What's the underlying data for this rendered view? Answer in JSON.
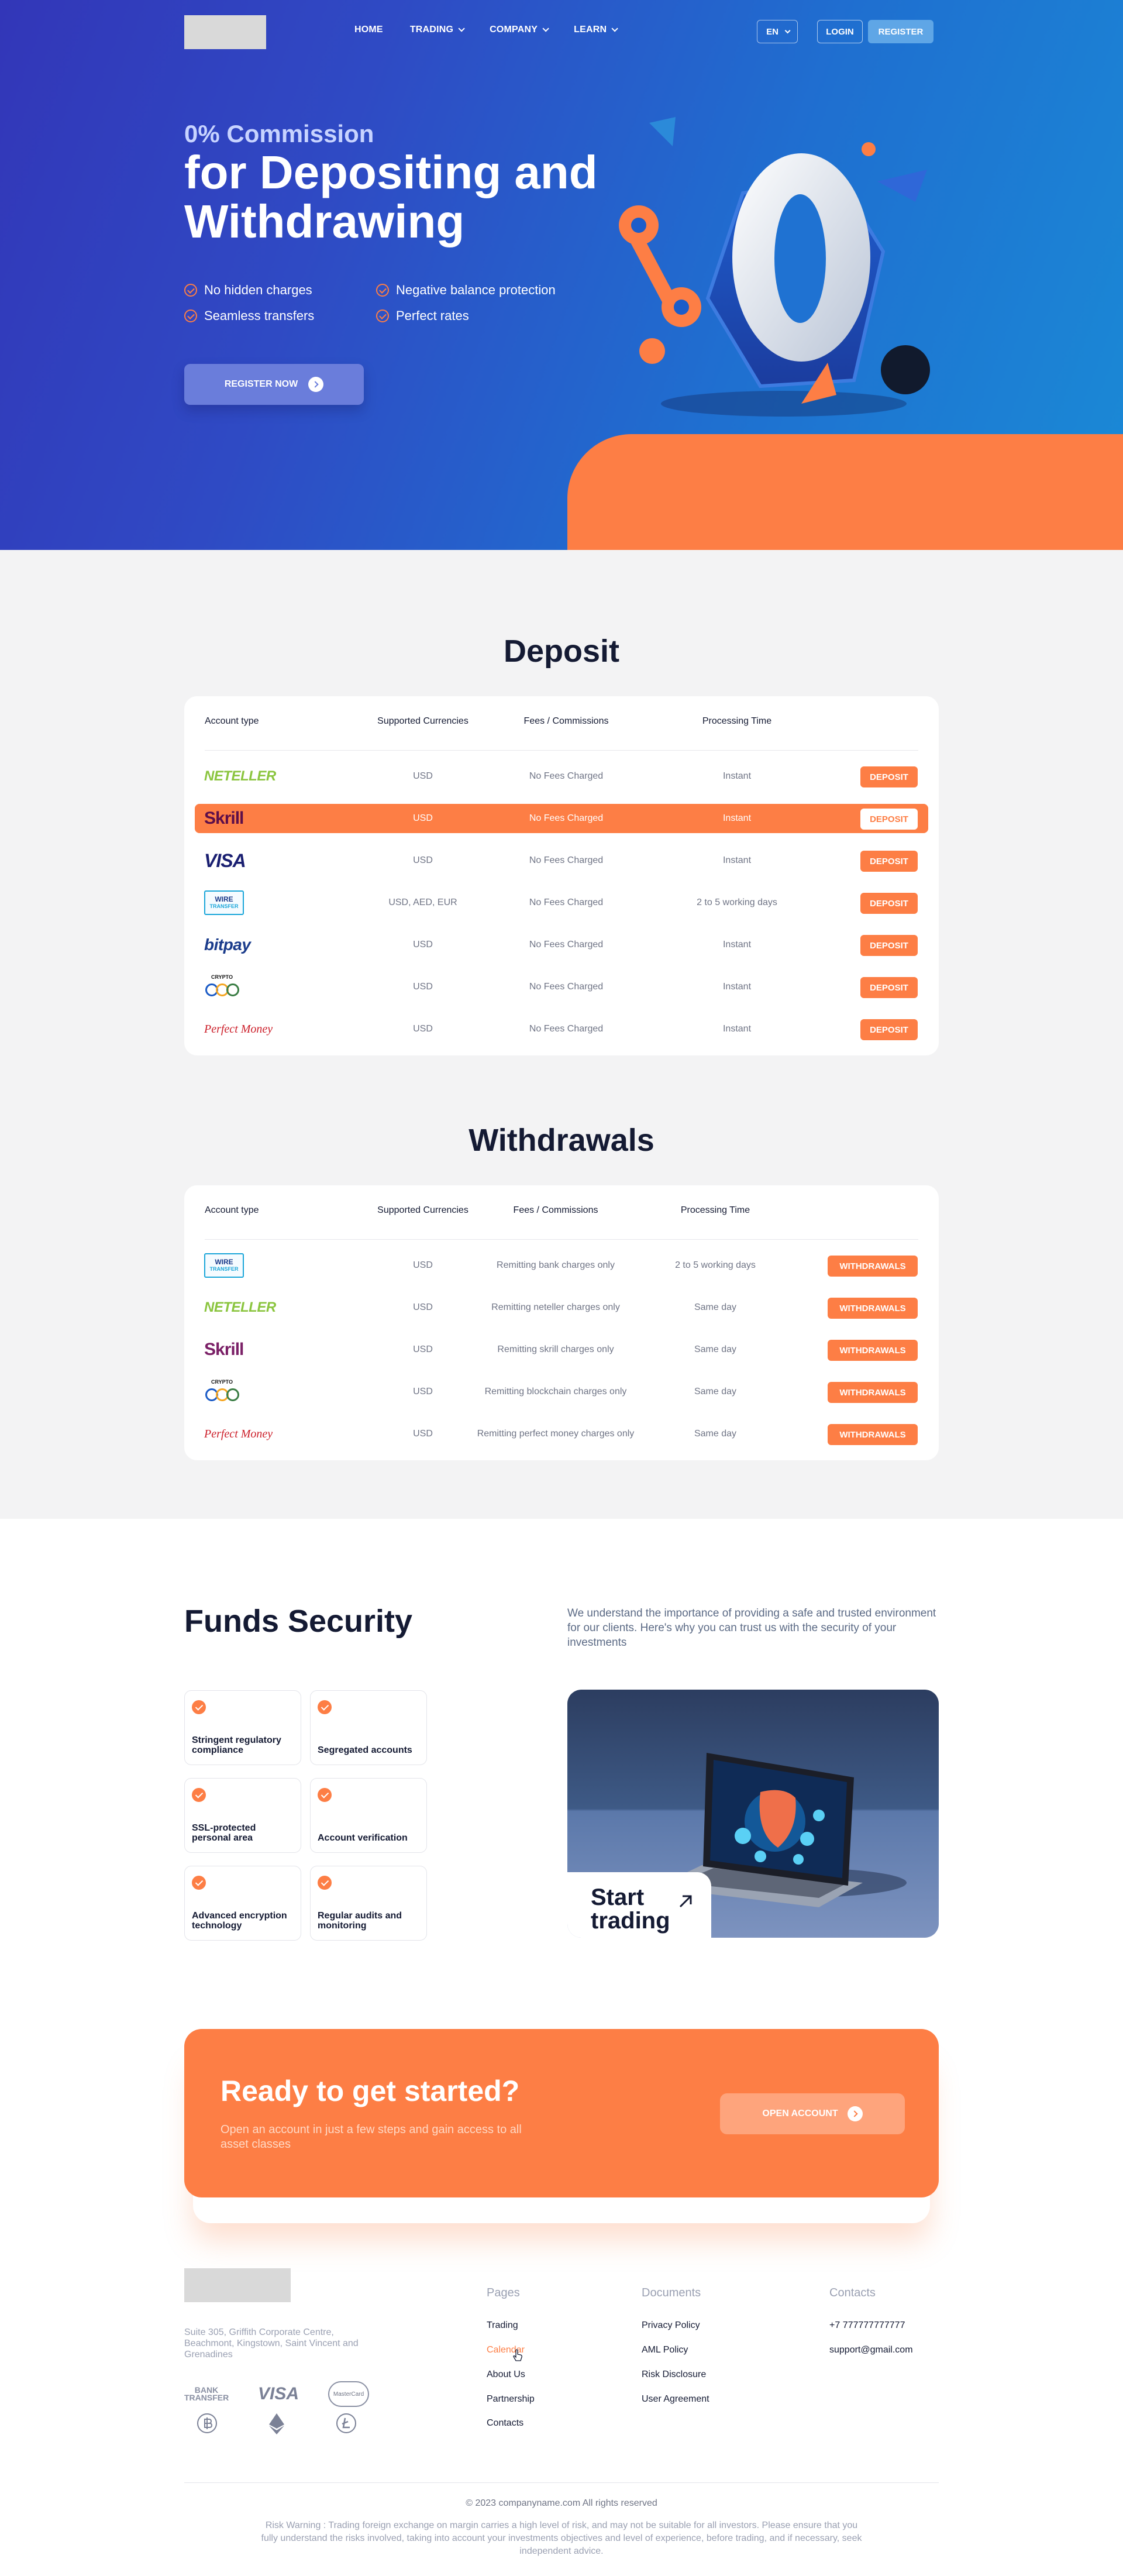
{
  "header": {
    "nav": [
      {
        "label": "HOME",
        "dropdown": false
      },
      {
        "label": "TRADING",
        "dropdown": true
      },
      {
        "label": "COMPANY",
        "dropdown": true
      },
      {
        "label": "LEARN",
        "dropdown": true
      }
    ],
    "lang": "EN",
    "login": "LOGIN",
    "register": "REGISTER"
  },
  "hero": {
    "subtitle": "0% Commission",
    "title": "for Depositing and Withdrawing",
    "features": [
      "No hidden charges",
      "Negative balance protection",
      "Seamless transfers",
      "Perfect rates"
    ],
    "cta": "REGISTER NOW"
  },
  "deposit": {
    "title": "Deposit",
    "headers": [
      "Account type",
      "Supported Currencies",
      "Fees / Commissions",
      "Processing Time"
    ],
    "rows": [
      {
        "logo": "neteller-logo",
        "currencies": "USD",
        "fees": "No Fees Charged",
        "time": "Instant",
        "action": "DEPOSIT"
      },
      {
        "logo": "skrill-logo",
        "currencies": "USD",
        "fees": "No Fees Charged",
        "time": "Instant",
        "action": "DEPOSIT",
        "highlighted": true
      },
      {
        "logo": "visa-logo",
        "currencies": "USD",
        "fees": "No Fees Charged",
        "time": "Instant",
        "action": "DEPOSIT"
      },
      {
        "logo": "wire-transfer-logo",
        "currencies": "USD, AED, EUR",
        "fees": "No Fees Charged",
        "time": "2 to 5 working days",
        "action": "DEPOSIT"
      },
      {
        "logo": "bitpay-logo",
        "currencies": "USD",
        "fees": "No Fees Charged",
        "time": "Instant",
        "action": "DEPOSIT"
      },
      {
        "logo": "crypto-coins-logo",
        "currencies": "USD",
        "fees": "No Fees Charged",
        "time": "Instant",
        "action": "DEPOSIT"
      },
      {
        "logo": "perfect-money-logo",
        "currencies": "USD",
        "fees": "No Fees Charged",
        "time": "Instant",
        "action": "DEPOSIT"
      }
    ]
  },
  "withdrawals": {
    "title": "Withdrawals",
    "headers": [
      "Account type",
      "Supported Currencies",
      "Fees / Commissions",
      "Processing Time"
    ],
    "rows": [
      {
        "logo": "wire-transfer-logo",
        "currencies": "USD",
        "fees": "Remitting bank charges only",
        "time": "2 to 5 working days",
        "action": "WITHDRAWALS"
      },
      {
        "logo": "neteller-logo",
        "currencies": "USD",
        "fees": "Remitting neteller charges only",
        "time": "Same day",
        "action": "WITHDRAWALS"
      },
      {
        "logo": "skrill-logo",
        "currencies": "USD",
        "fees": "Remitting skrill charges only",
        "time": "Same day",
        "action": "WITHDRAWALS"
      },
      {
        "logo": "crypto-coins-logo",
        "currencies": "USD",
        "fees": "Remitting blockchain charges only",
        "time": "Same day",
        "action": "WITHDRAWALS"
      },
      {
        "logo": "perfect-money-logo",
        "currencies": "USD",
        "fees": "Remitting perfect money charges only",
        "time": "Same day",
        "action": "WITHDRAWALS"
      }
    ]
  },
  "logos": {
    "neteller": "NETELLER",
    "skrill": "Skrill",
    "visa": "VISA",
    "wire_top": "WIRE",
    "wire_bottom": "TRANSFER",
    "bitpay": "bitpay",
    "crypto": "CRYPTO",
    "perfect_money": "Perfect Money"
  },
  "security": {
    "title": "Funds Security",
    "description": "We understand the importance of providing a safe and trusted environment for our clients. Here's why you can trust us with the security of your investments",
    "items": [
      "Stringent regulatory compliance",
      "Segregated accounts",
      "SSL-protected personal area",
      "Account verification",
      "Advanced encryption technology",
      "Regular audits and monitoring"
    ],
    "start_trading": "Start trading"
  },
  "cta": {
    "title": "Ready to get started?",
    "description": "Open an account in just a few steps and gain access to all asset classes",
    "button": "OPEN ACCOUNT"
  },
  "footer": {
    "address": "Suite 305, Griffith Corporate Centre, Beachmont, Kingstown, Saint Vincent and Grenadines",
    "payment": {
      "bank_top": "BANK",
      "bank_bottom": "TRANSFER",
      "visa": "VISA",
      "mastercard": "MasterCard"
    },
    "pages_title": "Pages",
    "pages": [
      "Trading",
      "Calendar",
      "About Us",
      "Partnership",
      "Contacts"
    ],
    "documents_title": "Documents",
    "documents": [
      "Privacy Policy",
      "AML Policy",
      "Risk Disclosure",
      "User Agreement"
    ],
    "contacts_title": "Contacts",
    "contacts": [
      "+7 777777777777",
      "support@gmail.com"
    ],
    "copyright": "© 2023 companyname.com All rights reserved",
    "risk": "Risk Warning : Trading foreign exchange on margin carries a high level of risk, and may not be suitable for all investors. Please ensure that you fully understand the risks involved, taking into account your investments objectives and level of experience, before trading, and if necessary, seek independent advice."
  },
  "colors": {
    "accent": "#fd7e45",
    "hero_start": "#3236b8",
    "hero_end": "#1a8ad6",
    "text_dark": "#141a33",
    "page_bg": "#f3f3f4"
  }
}
